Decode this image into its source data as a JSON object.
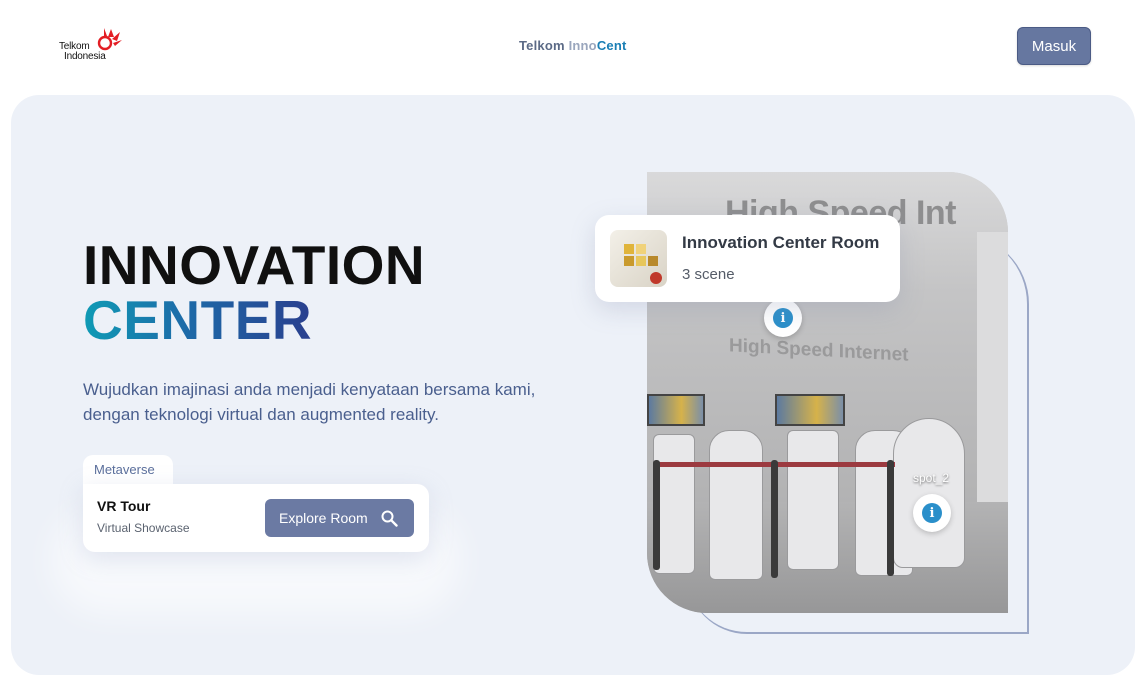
{
  "header": {
    "logo_line1": "Telkom",
    "logo_line2": "Indonesia",
    "brand_part1": "Telkom ",
    "brand_part2": "Inno",
    "brand_part3": "Cent",
    "login_label": "Masuk"
  },
  "hero": {
    "title_line1": "INNOVATION",
    "title_line2": "CENTER",
    "description": "Wujudkan imajinasi anda menjadi kenyataan bersama kami, dengan teknologi virtual dan augmented reality.",
    "tab_label": "Metaverse",
    "card_title": "VR Tour",
    "card_subtitle": "Virtual Showcase",
    "explore_label": "Explore Room"
  },
  "scene": {
    "wall_text": "High Speed Int",
    "wall_text_lower": "High Speed Internet",
    "spot_label": "spot_2",
    "room_title": "Innovation Center Room",
    "room_subtitle": "3 scene"
  },
  "colors": {
    "accent": "#6677a0",
    "title_gradient_start": "#0f9bb5",
    "title_gradient_end": "#2a3f8e",
    "hero_bg": "#edf1f8",
    "logo_red": "#e31e24"
  }
}
